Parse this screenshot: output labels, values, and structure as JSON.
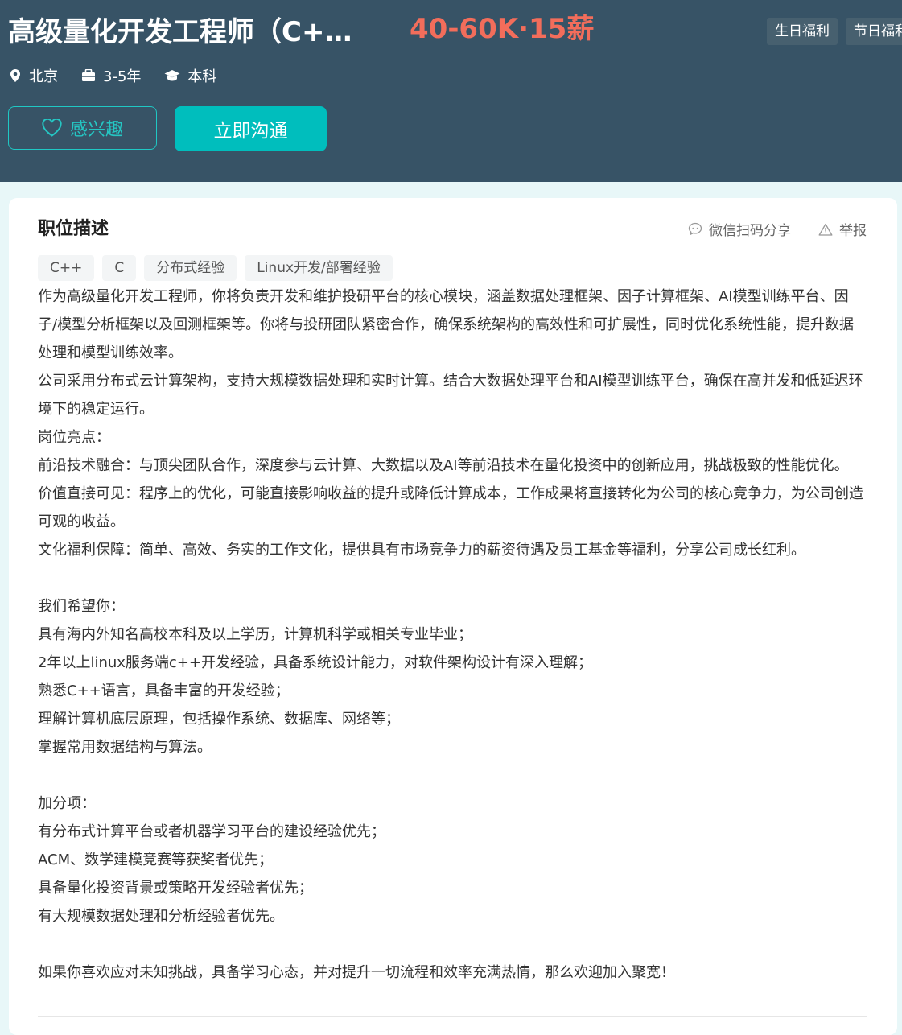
{
  "header": {
    "title": "高级量化开发工程师（C++方向）",
    "salary": "40-60K·15薪",
    "welfare": [
      "生日福利",
      "节日福利"
    ],
    "meta": {
      "city": "北京",
      "experience": "3-5年",
      "degree": "本科"
    },
    "icons": {
      "city": "location-pin-icon",
      "experience": "briefcase-icon",
      "degree": "graduation-cap-icon",
      "interest": "heart-icon"
    },
    "buttons": {
      "interest": "感兴趣",
      "chat": "立即沟通"
    }
  },
  "description": {
    "title": "职位描述",
    "actions": {
      "share": "微信扫码分享",
      "report": "举报"
    },
    "skills": [
      "C++",
      "C",
      "分布式经验",
      "Linux开发/部署经验"
    ],
    "paragraphs": [
      "作为高级量化开发工程师，你将负责开发和维护投研平台的核心模块，涵盖数据处理框架、因子计算框架、AI模型训练平台、因子/模型分析框架以及回测框架等。你将与投研团队紧密合作，确保系统架构的高效性和可扩展性，同时优化系统性能，提升数据处理和模型训练效率。",
      "公司采用分布式云计算架构，支持大规模数据处理和实时计算。结合大数据处理平台和AI模型训练平台，确保在高并发和低延迟环境下的稳定运行。",
      "岗位亮点：",
      "前沿技术融合：与顶尖团队合作，深度参与云计算、大数据以及AI等前沿技术在量化投资中的创新应用，挑战极致的性能优化。",
      "价值直接可见：程序上的优化，可能直接影响收益的提升或降低计算成本，工作成果将直接转化为公司的核心竞争力，为公司创造可观的收益。",
      "文化福利保障：简单、高效、务实的工作文化，提供具有市场竞争力的薪资待遇及员工基金等福利，分享公司成长红利。",
      "",
      "我们希望你：",
      "具有海内外知名高校本科及以上学历，计算机科学或相关专业毕业；",
      "2年以上linux服务端c++开发经验，具备系统设计能力，对软件架构设计有深入理解；",
      "熟悉C++语言，具备丰富的开发经验；",
      "理解计算机底层原理，包括操作系统、数据库、网络等；",
      "掌握常用数据结构与算法。",
      "",
      "加分项：",
      "有分布式计算平台或者机器学习平台的建设经验优先；",
      "ACM、数学建模竞赛等获奖者优先；",
      "具备量化投资背景或策略开发经验者优先；",
      "有大规模数据处理和分析经验者优先。",
      "",
      "如果你喜欢应对未知挑战，具备学习心态，并对提升一切流程和效率充满热情，那么欢迎加入聚宽！"
    ]
  },
  "colors": {
    "header_bg": "#375366",
    "salary": "#f26d5b",
    "accent": "#00bebd",
    "page_bg": "#e8f7f8"
  }
}
